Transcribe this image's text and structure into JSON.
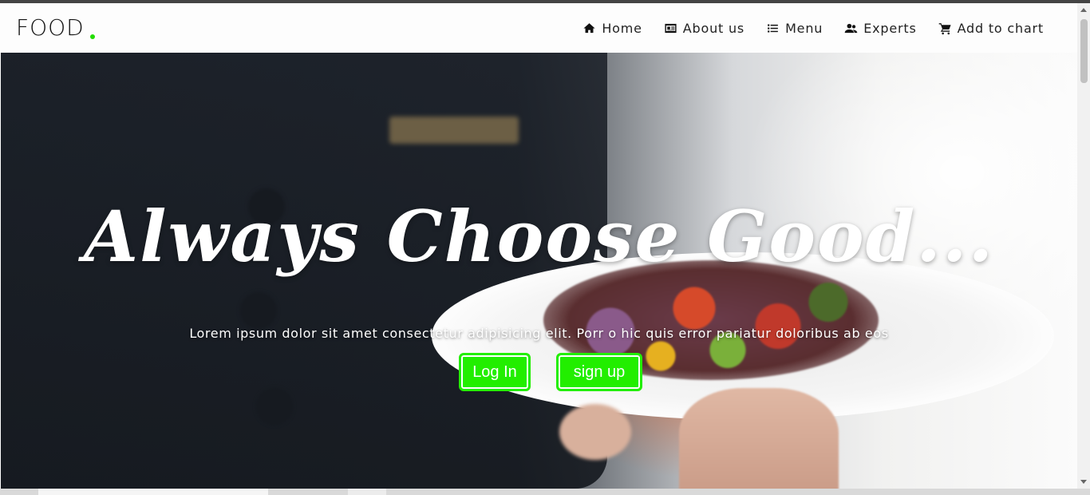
{
  "brand": {
    "name": "FOOD",
    "dot_color": "#22dd00"
  },
  "nav": {
    "items": [
      {
        "label": "Home",
        "icon": "home-icon"
      },
      {
        "label": "About us",
        "icon": "id-card-icon"
      },
      {
        "label": "Menu",
        "icon": "list-icon"
      },
      {
        "label": "Experts",
        "icon": "users-icon"
      },
      {
        "label": "Add to chart",
        "icon": "cart-icon"
      }
    ]
  },
  "hero": {
    "headline": "Always Choose Good...",
    "subtitle": "Lorem ipsum dolor sit amet consectetur adipisicing elit. Porr o hic quis error pariatur doloribus ab eos",
    "login_label": "Log In",
    "signup_label": "sign up",
    "accent_color": "#22ee00"
  }
}
